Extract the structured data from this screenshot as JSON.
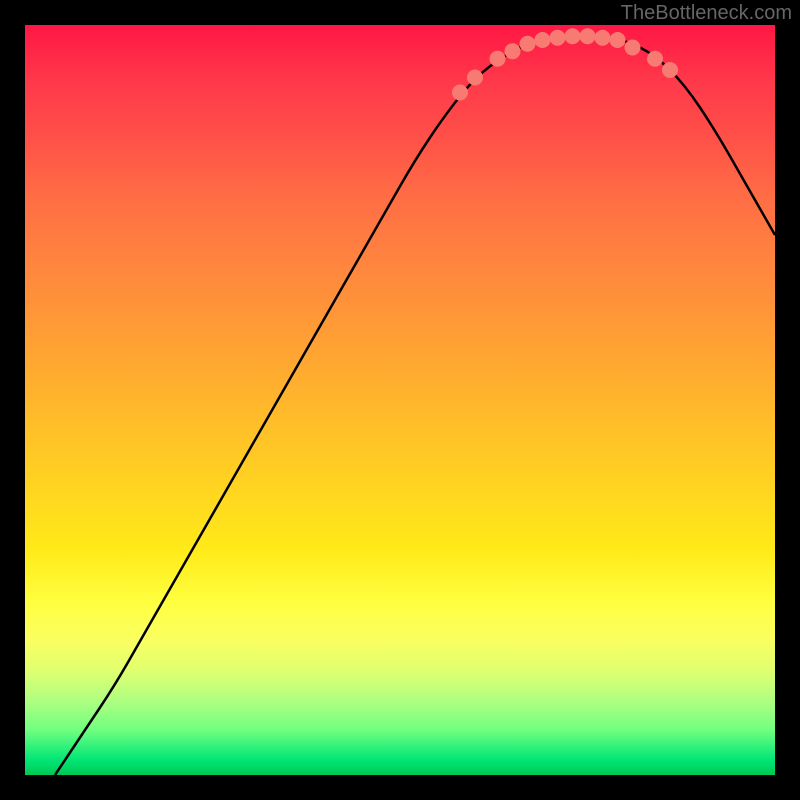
{
  "attribution": "TheBottleneck.com",
  "chart_data": {
    "type": "line",
    "title": "",
    "xlabel": "",
    "ylabel": "",
    "ylim": [
      0,
      100
    ],
    "xlim": [
      0,
      100
    ],
    "curve_points": [
      {
        "x": 4,
        "y": 0
      },
      {
        "x": 8,
        "y": 6
      },
      {
        "x": 12,
        "y": 12
      },
      {
        "x": 16,
        "y": 19
      },
      {
        "x": 20,
        "y": 26
      },
      {
        "x": 24,
        "y": 33
      },
      {
        "x": 28,
        "y": 40
      },
      {
        "x": 32,
        "y": 47
      },
      {
        "x": 36,
        "y": 54
      },
      {
        "x": 40,
        "y": 61
      },
      {
        "x": 44,
        "y": 68
      },
      {
        "x": 48,
        "y": 75
      },
      {
        "x": 52,
        "y": 82
      },
      {
        "x": 56,
        "y": 88
      },
      {
        "x": 60,
        "y": 93
      },
      {
        "x": 64,
        "y": 96
      },
      {
        "x": 68,
        "y": 98
      },
      {
        "x": 72,
        "y": 98.5
      },
      {
        "x": 76,
        "y": 98.5
      },
      {
        "x": 80,
        "y": 98
      },
      {
        "x": 84,
        "y": 96
      },
      {
        "x": 88,
        "y": 92
      },
      {
        "x": 92,
        "y": 86
      },
      {
        "x": 96,
        "y": 79
      },
      {
        "x": 100,
        "y": 72
      }
    ],
    "dots": [
      {
        "x": 58,
        "y": 91
      },
      {
        "x": 60,
        "y": 93
      },
      {
        "x": 63,
        "y": 95.5
      },
      {
        "x": 65,
        "y": 96.5
      },
      {
        "x": 67,
        "y": 97.5
      },
      {
        "x": 69,
        "y": 98
      },
      {
        "x": 71,
        "y": 98.3
      },
      {
        "x": 73,
        "y": 98.5
      },
      {
        "x": 75,
        "y": 98.5
      },
      {
        "x": 77,
        "y": 98.3
      },
      {
        "x": 79,
        "y": 98
      },
      {
        "x": 81,
        "y": 97
      },
      {
        "x": 84,
        "y": 95.5
      },
      {
        "x": 86,
        "y": 94
      }
    ],
    "dot_color": "#f77b72",
    "curve_color": "#000000"
  }
}
